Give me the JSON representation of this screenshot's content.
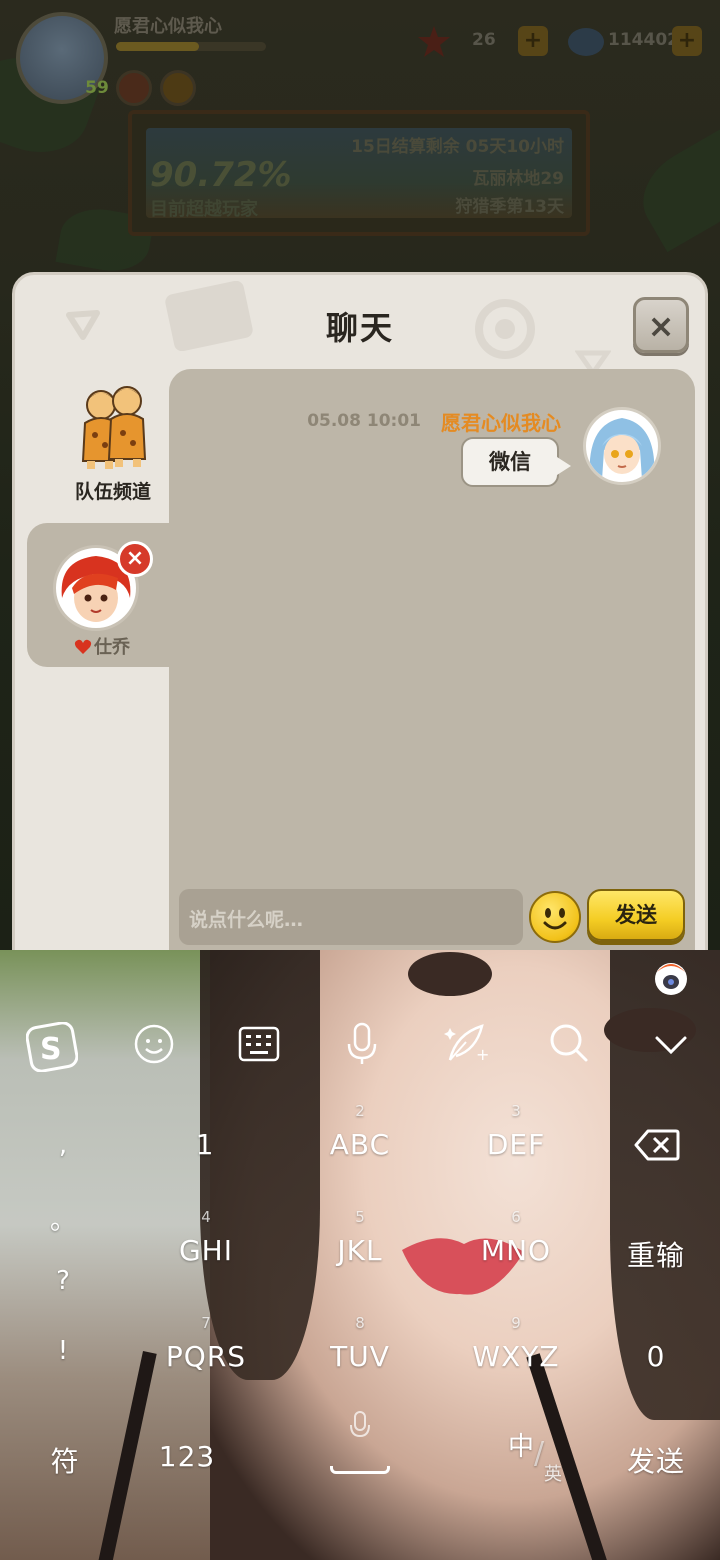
{
  "hud": {
    "player_name": "愿君心似我心",
    "player_level": "59",
    "player_xp_fraction": 0.55,
    "star_count": "26",
    "shell_count": "114402",
    "plus_label": "+",
    "season_percent": "90.72%",
    "season_percent_caption": "目前超越玩家",
    "season_end": "15日结算剩余 05天10小时",
    "season_map": "瓦丽林地29",
    "season_rank": "狩猎季第13天"
  },
  "chat": {
    "title": "聊天",
    "close_label": "×",
    "team_channel_label": "队伍频道",
    "contact_name": "仕乔",
    "remove_label": "×",
    "message": {
      "time": "05.08 10:01",
      "sender": "愿君心似我心",
      "text": "微信"
    },
    "input_placeholder": "说点什么呢…",
    "send_label": "发送"
  },
  "keyboard": {
    "punct_keys": [
      ",",
      "。",
      "?",
      "!"
    ],
    "row1": [
      {
        "num": "",
        "main": "1"
      },
      {
        "num": "2",
        "main": "ABC"
      },
      {
        "num": "3",
        "main": "DEF"
      }
    ],
    "row2": [
      {
        "num": "4",
        "main": "GHI"
      },
      {
        "num": "5",
        "main": "JKL"
      },
      {
        "num": "6",
        "main": "MNO"
      }
    ],
    "row3": [
      {
        "num": "7",
        "main": "PQRS"
      },
      {
        "num": "8",
        "main": "TUV"
      },
      {
        "num": "9",
        "main": "WXYZ"
      }
    ],
    "reenter_label": "重输",
    "zero_label": "0",
    "symbol_label": "符",
    "num_label": "123",
    "lang_zh": "中",
    "lang_en": "英",
    "send_label": "发送",
    "accent_color": "#ffffff"
  }
}
